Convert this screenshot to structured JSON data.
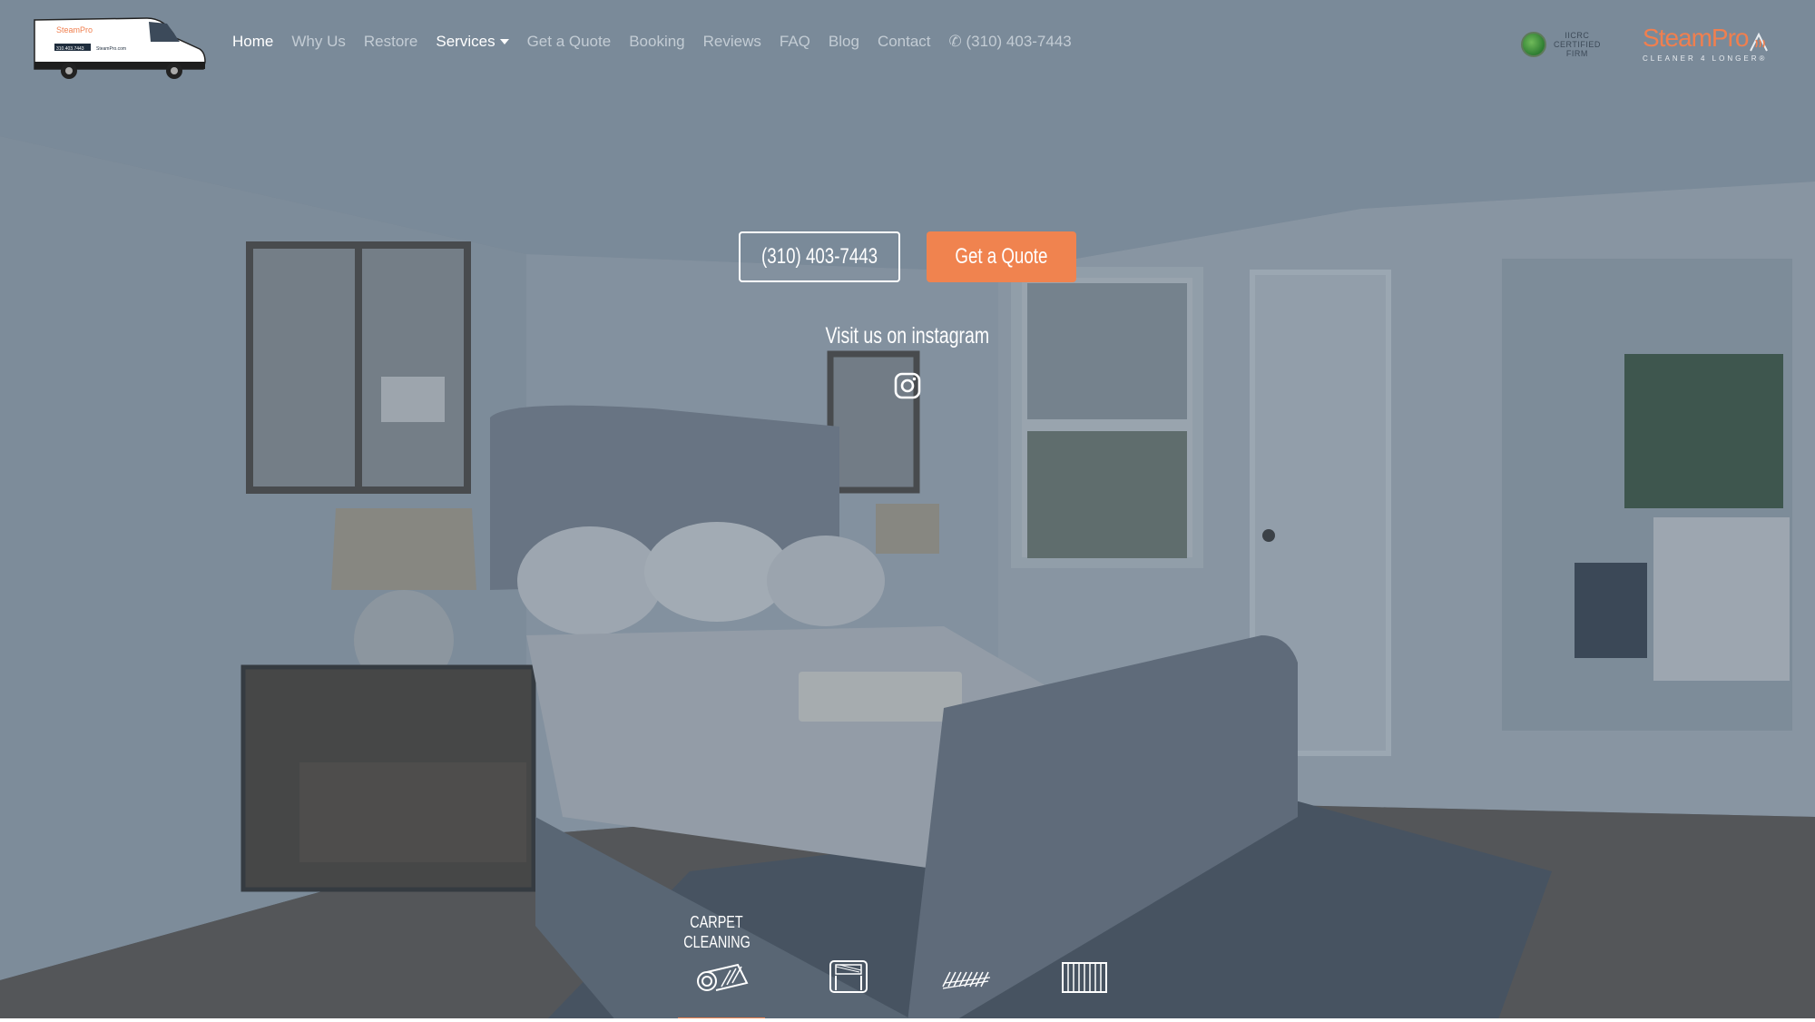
{
  "nav": {
    "links": [
      {
        "label": "Home"
      },
      {
        "label": "Why Us"
      },
      {
        "label": "Restore"
      },
      {
        "label": "Services"
      },
      {
        "label": "Get a Quote"
      },
      {
        "label": "Booking"
      },
      {
        "label": "Reviews"
      },
      {
        "label": "FAQ"
      },
      {
        "label": "Blog"
      },
      {
        "label": "Contact"
      },
      {
        "label": "✆ (310) 403-7443"
      }
    ],
    "logo_van_icon": "service-van-logo-icon"
  },
  "van_text": {
    "brand": "SteamPro",
    "phone": "310.403.7443",
    "url": "SteamPro.com"
  },
  "certification": {
    "lines": [
      "IICRC",
      "CERTIFIED",
      "FIRM"
    ],
    "icon": "iicrc-globe-icon"
  },
  "brand": {
    "name": "SteamPro",
    "tagline": "CLEANER 4 LONGER®",
    "icon": "steam-waves-icon",
    "color": "#f07f4f"
  },
  "hero": {
    "phone_button": "(310) 403-7443",
    "quote_button": "Get a Quote",
    "instagram_label": "Visit us on instagram",
    "instagram_icon": "instagram-icon",
    "accent_color": "#f0834f"
  },
  "services": [
    {
      "label_line1": "CARPET",
      "label_line2": "CLEANING",
      "icon": "carpet-roll-icon",
      "active": true
    },
    {
      "label_line1": "",
      "label_line2": "",
      "icon": "upholstery-chair-icon",
      "active": false
    },
    {
      "label_line1": "",
      "label_line2": "",
      "icon": "rug-fringe-icon",
      "active": false
    },
    {
      "label_line1": "",
      "label_line2": "",
      "icon": "tile-grout-icon",
      "active": false
    }
  ]
}
